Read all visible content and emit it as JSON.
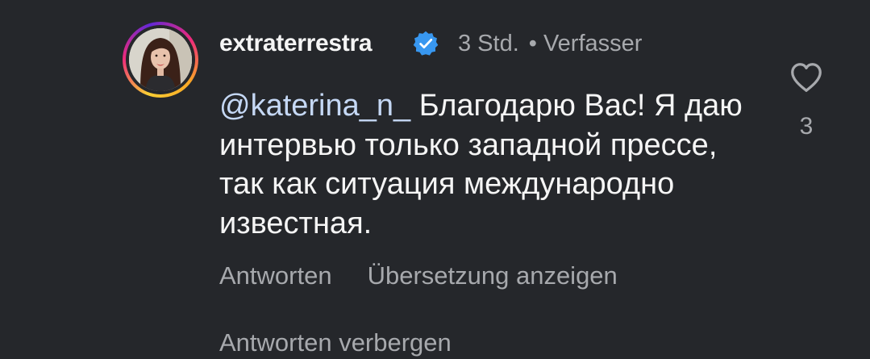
{
  "comment": {
    "username": "extraterrestra",
    "verified_icon": "verified-badge-icon",
    "time": "3 Std.",
    "separator": "•",
    "author_label": "Verfasser",
    "mention": "@katerina_n_",
    "text": "Благодарю Вас! Я даю интервью только западной прессе, так как ситуация международно известная.",
    "like_icon": "heart-outline-icon",
    "like_count": "3",
    "reply_label": "Antworten",
    "translate_label": "Übersetzung anzeigen",
    "hide_replies_label": "Antworten verbergen"
  },
  "colors": {
    "background": "#25272b",
    "primary_text": "#f5f5f5",
    "secondary_text": "#a7a9ad",
    "mention": "#c5d8f5",
    "verified_blue": "#3897f0"
  }
}
